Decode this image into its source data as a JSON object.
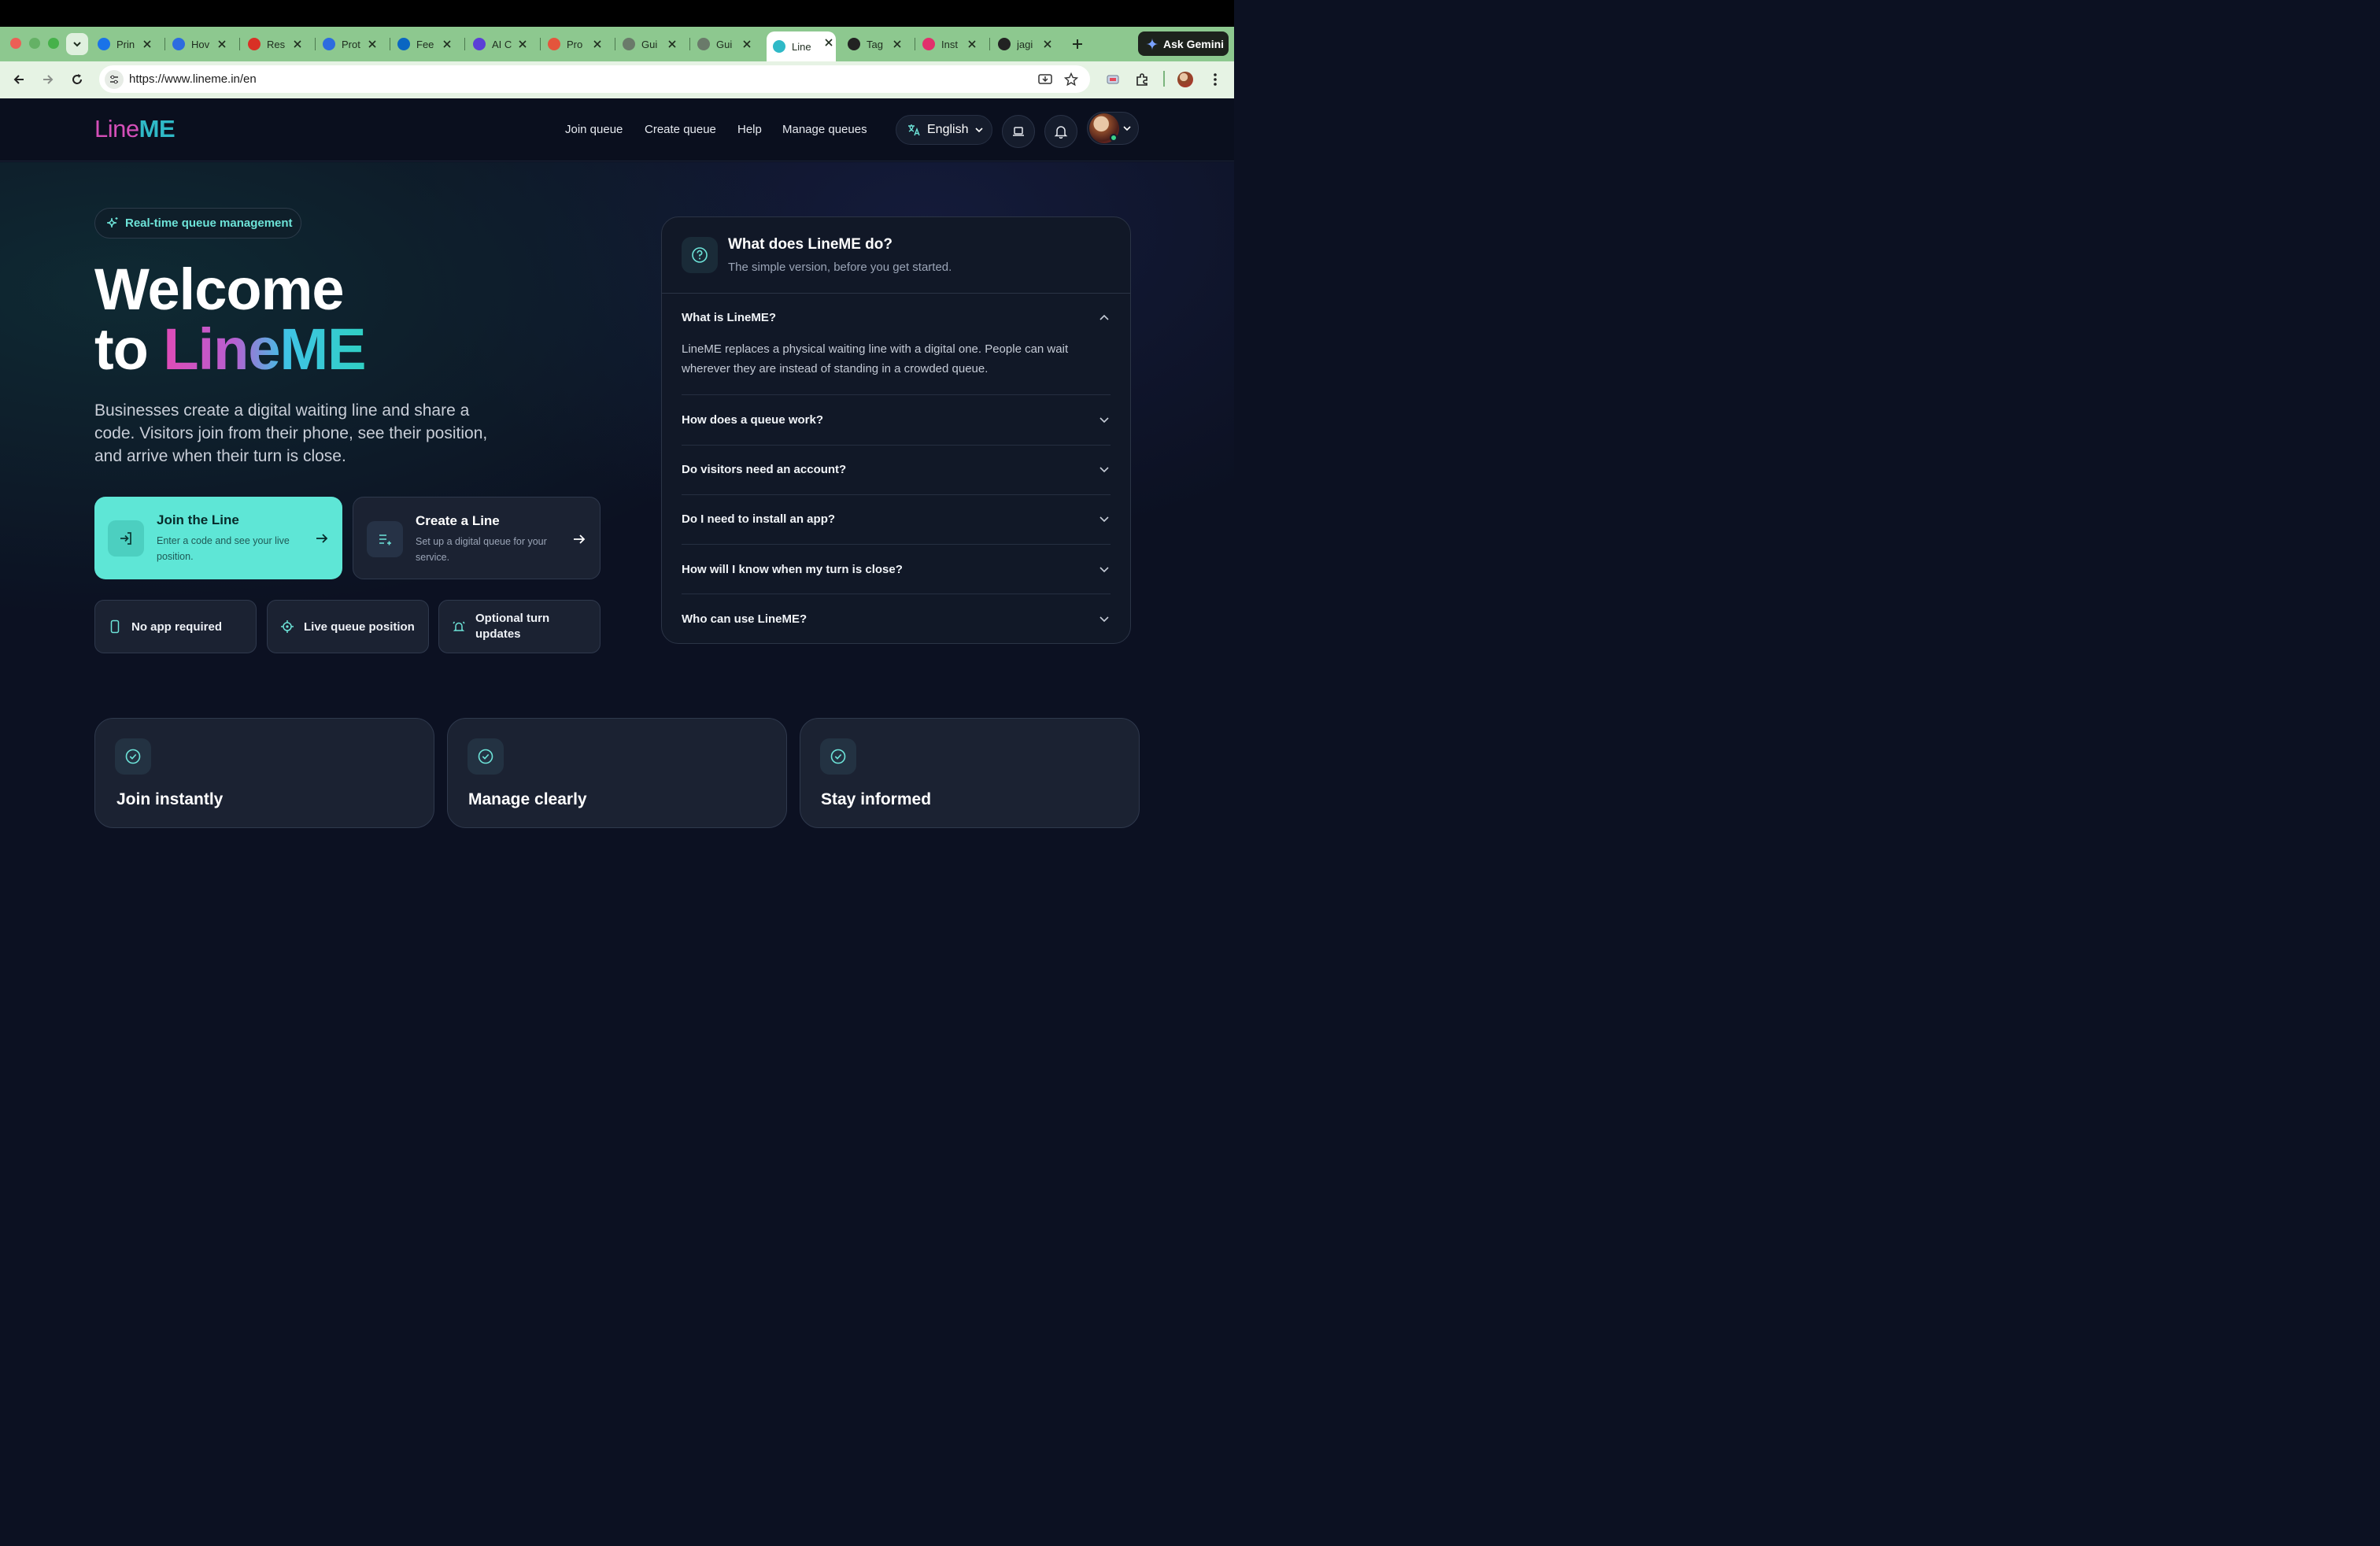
{
  "browser": {
    "tabs": [
      {
        "label": "Prin",
        "icon": "play-icon",
        "color": "#1a73e8"
      },
      {
        "label": "Hov",
        "icon": "bbn-icon",
        "color": "#2d6cdf"
      },
      {
        "label": "Res",
        "icon": "gmail-icon",
        "color": "#d93025"
      },
      {
        "label": "Prot",
        "icon": "bbn-icon",
        "color": "#2d6cdf"
      },
      {
        "label": "Fee",
        "icon": "linkedin-icon",
        "color": "#0a66c2"
      },
      {
        "label": "AI C",
        "icon": "rocket-icon",
        "color": "#5b3fd6"
      },
      {
        "label": "Pro",
        "icon": "producthunt-icon",
        "color": "#e4553c"
      },
      {
        "label": "Gui",
        "icon": "page-icon",
        "color": "#6a7a6a"
      },
      {
        "label": "Gui",
        "icon": "loading-icon",
        "color": "#6a7a6a"
      },
      {
        "label": "Line",
        "icon": "lineme-icon",
        "color": "#2fb9c7"
      },
      {
        "label": "Tag",
        "icon": "openai-icon",
        "color": "#222"
      },
      {
        "label": "Inst",
        "icon": "instagram-icon",
        "color": "#e1306c"
      },
      {
        "label": "jagi",
        "icon": "github-icon",
        "color": "#222"
      }
    ],
    "active_tab_index": 9,
    "gemini_label": "Ask Gemini",
    "url": "https://www.lineme.in/en"
  },
  "header": {
    "logo": {
      "part1": "Line",
      "part2": "M",
      "part3": "E"
    },
    "nav": [
      "Join queue",
      "Create queue",
      "Help",
      "Manage queues"
    ],
    "language": "English"
  },
  "hero": {
    "badge": "Real-time queue management",
    "title_line1": "Welcome",
    "title_line2_prefix": "to ",
    "title_brand": "LineME",
    "lead": "Businesses create a digital waiting line and share a code. Visitors join from their phone, see their position, and arrive when their turn is close.",
    "cta_primary": {
      "title": "Join the Line",
      "desc": "Enter a code and see your live position."
    },
    "cta_secondary": {
      "title": "Create a Line",
      "desc": "Set up a digital queue for your service."
    },
    "features": [
      "No app required",
      "Live queue position",
      "Optional turn updates"
    ]
  },
  "faq": {
    "title": "What does LineME do?",
    "subtitle": "The simple version, before you get started.",
    "items": [
      {
        "q": "What is LineME?",
        "a": "LineME replaces a physical waiting line with a digital one. People can wait wherever they are instead of standing in a crowded queue.",
        "open": true
      },
      {
        "q": "How does a queue work?",
        "open": false
      },
      {
        "q": "Do visitors need an account?",
        "open": false
      },
      {
        "q": "Do I need to install an app?",
        "open": false
      },
      {
        "q": "How will I know when my turn is close?",
        "open": false
      },
      {
        "q": "Who can use LineME?",
        "open": false
      }
    ]
  },
  "bottom_cards": [
    "Join instantly",
    "Manage clearly",
    "Stay informed"
  ],
  "colors": {
    "accent_teal": "#5ee6d6",
    "brand_pink": "#e04bb6",
    "brand_cyan": "#2fd0c3",
    "background": "#0c1122"
  }
}
